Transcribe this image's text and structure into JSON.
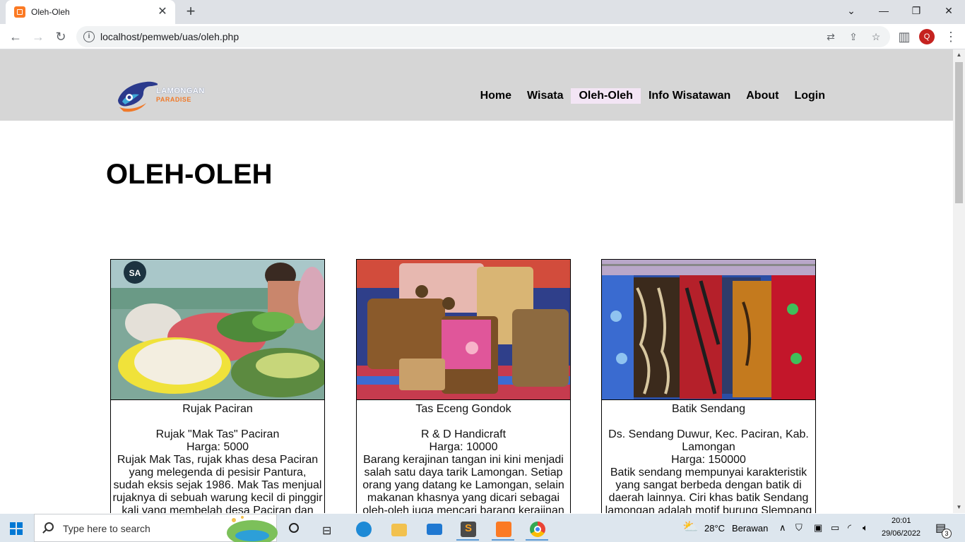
{
  "browser": {
    "tab_title": "Oleh-Oleh",
    "url": "localhost/pemweb/uas/oleh.php",
    "profile_initial": "Q"
  },
  "site": {
    "logo": {
      "line1": "LAMONGAN",
      "line2": "PARADISE"
    },
    "nav": [
      {
        "label": "Home",
        "active": false
      },
      {
        "label": "Wisata",
        "active": false
      },
      {
        "label": "Oleh-Oleh",
        "active": true
      },
      {
        "label": "Info Wisatawan",
        "active": false
      },
      {
        "label": "About",
        "active": false
      },
      {
        "label": "Login",
        "active": false
      }
    ],
    "page_title": "OLEH-OLEH"
  },
  "products": [
    {
      "name": "Rujak Paciran",
      "store": "Rujak \"Mak Tas\" Paciran",
      "price": "Harga: 5000",
      "description": "Rujak Mak Tas, rujak khas desa Paciran yang melegenda di pesisir Pantura, sudah eksis sejak 1986. Mak Tas menjual rujaknya di sebuah warung kecil di pinggir kali yang membelah desa Paciran dan"
    },
    {
      "name": "Tas Eceng Gondok",
      "store": "R & D Handicraft",
      "price": "Harga: 10000",
      "description": "Barang kerajinan tangan ini kini menjadi salah satu daya tarik Lamongan. Setiap orang yang datang ke Lamongan, selain makanan khasnya yang dicari sebagai oleh-oleh juga mencari barang kerajinan"
    },
    {
      "name": "Batik Sendang",
      "store": "Ds. Sendang Duwur, Kec. Paciran, Kab. Lamongan",
      "price": "Harga: 150000",
      "description": "Batik sendang mempunyai karakteristik yang sangat berbeda dengan batik di daerah lainnya. Ciri khas batik Sendang lamongan adalah motif burung Slempang"
    }
  ],
  "taskbar": {
    "search_placeholder": "Type here to search",
    "weather_temp": "28°C",
    "weather_desc": "Berawan",
    "time": "20:01",
    "date": "29/06/2022",
    "notification_count": "3"
  }
}
